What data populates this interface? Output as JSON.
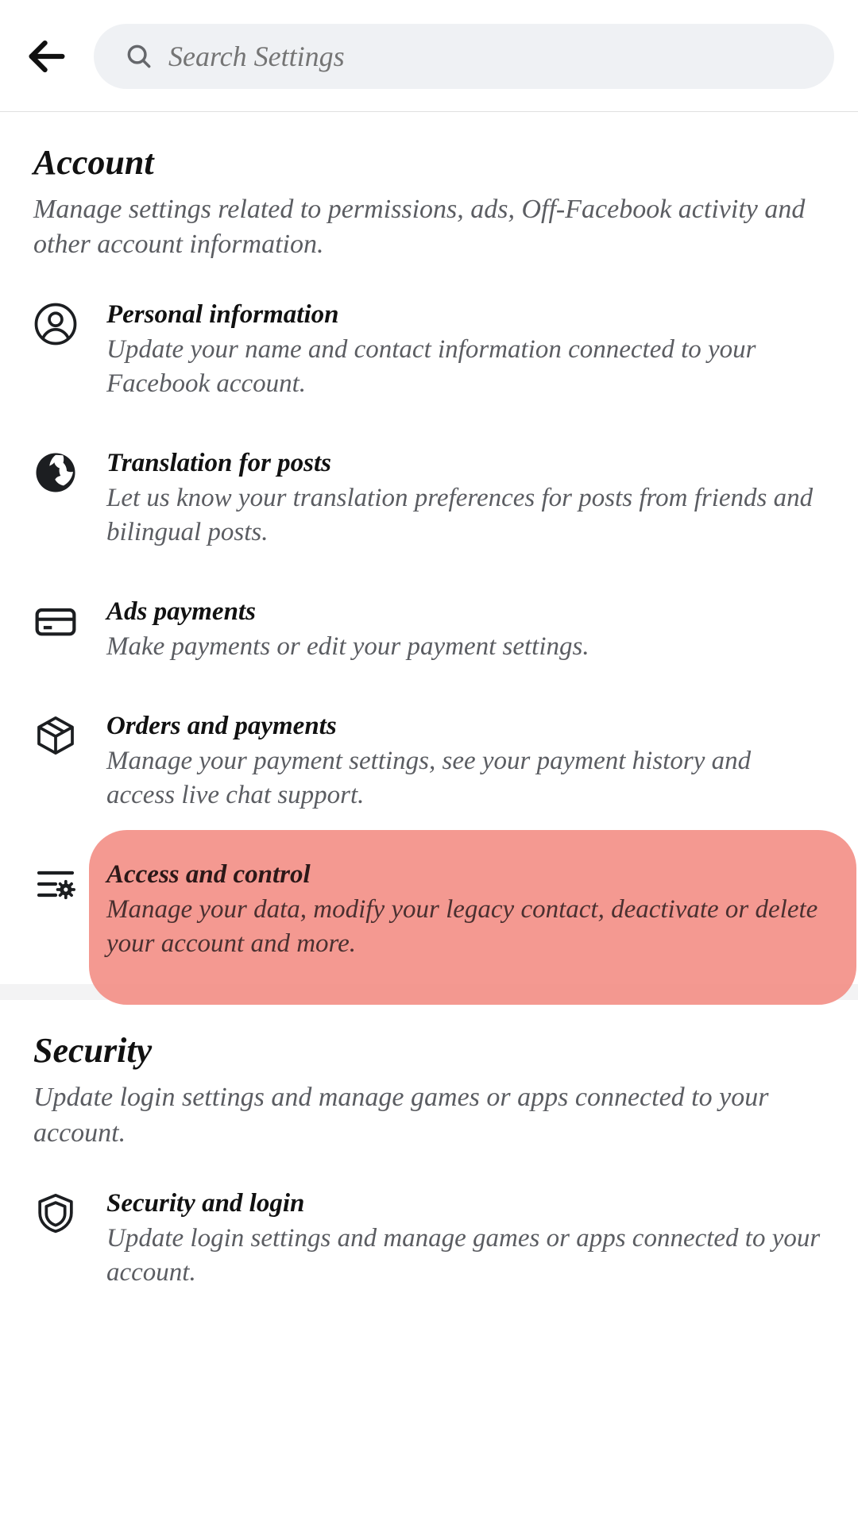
{
  "header": {
    "search_placeholder": "Search Settings"
  },
  "sections": [
    {
      "title": "Account",
      "desc": "Manage settings related to permissions, ads, Off-Facebook activity and other account information.",
      "items": [
        {
          "icon": "person-icon",
          "title": "Personal information",
          "desc": "Update your name and contact information connected to your Facebook account."
        },
        {
          "icon": "globe-icon",
          "title": "Translation for posts",
          "desc": "Let us know your translation preferences for posts from friends and bilingual posts."
        },
        {
          "icon": "card-icon",
          "title": "Ads payments",
          "desc": "Make payments or edit your payment settings."
        },
        {
          "icon": "package-icon",
          "title": "Orders and payments",
          "desc": "Manage your payment settings, see your payment history and access live chat support."
        },
        {
          "icon": "controls-icon",
          "title": "Access and control",
          "desc": "Manage your data, modify your legacy contact, deactivate or delete your account and more.",
          "highlighted": true
        }
      ]
    },
    {
      "title": "Security",
      "desc": "Update login settings and manage games or apps connected to your account.",
      "items": [
        {
          "icon": "shield-icon",
          "title": "Security and login",
          "desc": "Update login settings and manage games or apps connected to your account."
        }
      ]
    }
  ]
}
